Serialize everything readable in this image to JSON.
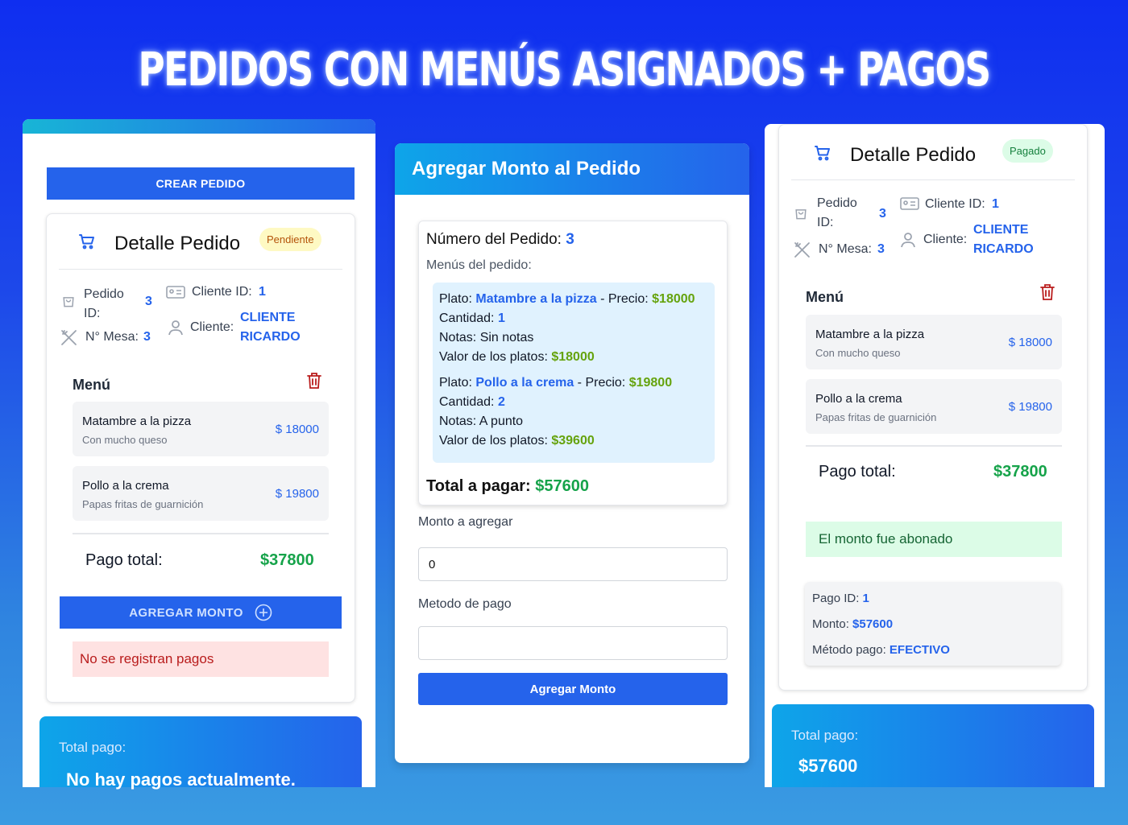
{
  "page_title": "PEDIDOS CON MENÚS ASIGNADOS + PAGOS",
  "left": {
    "create_button": "CREAR PEDIDO",
    "detail": {
      "title": "Detalle Pedido",
      "status": "Pendiente",
      "pedido_id_label": "Pedido ID:",
      "pedido_id": "3",
      "cliente_id_label": "Cliente ID:",
      "cliente_id": "1",
      "mesa_label": "N° Mesa:",
      "mesa": "3",
      "cliente_label": "Cliente:",
      "cliente_line1": "CLIENTE",
      "cliente_line2": "RICARDO",
      "menu_label": "Menú",
      "items": [
        {
          "name": "Matambre a la pizza",
          "note": "Con mucho queso",
          "price": "$ 18000"
        },
        {
          "name": "Pollo a la crema",
          "note": "Papas fritas de guarnición",
          "price": "$ 19800"
        }
      ],
      "total_label": "Pago total:",
      "total_value": "$37800",
      "add_button": "AGREGAR MONTO",
      "no_payments": "No se registran pagos"
    },
    "footer": {
      "label": "Total pago:",
      "value": "No hay pagos actualmente."
    }
  },
  "middle": {
    "header": "Agregar Monto al Pedido",
    "order_number_label": "Número del Pedido:",
    "order_number": "3",
    "menus_label": "Menús del pedido:",
    "lines": [
      {
        "plato_label": "Plato:",
        "plato": "Matambre a la pizza",
        "precio_label": "- Precio:",
        "precio": "$18000",
        "cantidad_label": "Cantidad:",
        "cantidad": "1",
        "notas": "Notas: Sin notas",
        "valor_label": "Valor de los platos:",
        "valor": "$18000"
      },
      {
        "plato_label": "Plato:",
        "plato": "Pollo a la crema",
        "precio_label": "- Precio:",
        "precio": "$19800",
        "cantidad_label": "Cantidad:",
        "cantidad": "2",
        "notas": "Notas: A punto",
        "valor_label": "Valor de los platos:",
        "valor": "$39600"
      }
    ],
    "total_label": "Total a pagar:",
    "total_value": "$57600",
    "monto_label": "Monto a agregar",
    "monto_value": "0",
    "metodo_label": "Metodo de pago",
    "metodo_value": "",
    "submit": "Agregar Monto"
  },
  "right": {
    "detail": {
      "title": "Detalle Pedido",
      "status": "Pagado",
      "pedido_id_label": "Pedido ID:",
      "pedido_id": "3",
      "cliente_id_label": "Cliente ID:",
      "cliente_id": "1",
      "mesa_label": "N° Mesa:",
      "mesa": "3",
      "cliente_label": "Cliente:",
      "cliente_line1": "CLIENTE",
      "cliente_line2": "RICARDO",
      "menu_label": "Menú",
      "items": [
        {
          "name": "Matambre a la pizza",
          "note": "Con mucho queso",
          "price": "$ 18000"
        },
        {
          "name": "Pollo a la crema",
          "note": "Papas fritas de guarnición",
          "price": "$ 19800"
        }
      ],
      "total_label": "Pago total:",
      "total_value": "$37800",
      "paid_msg": "El monto fue abonado",
      "payment": {
        "id_label": "Pago ID:",
        "id": "1",
        "monto_label": "Monto:",
        "monto": "$57600",
        "metodo_label": "Método pago:",
        "metodo": "EFECTIVO"
      }
    },
    "footer": {
      "label": "Total pago:",
      "value": "$57600"
    }
  },
  "colors": {
    "primary": "#2563eb",
    "green": "#16a34a",
    "red": "#b91c1c",
    "pending": "#fef9c3",
    "paid": "#dcfce7"
  }
}
